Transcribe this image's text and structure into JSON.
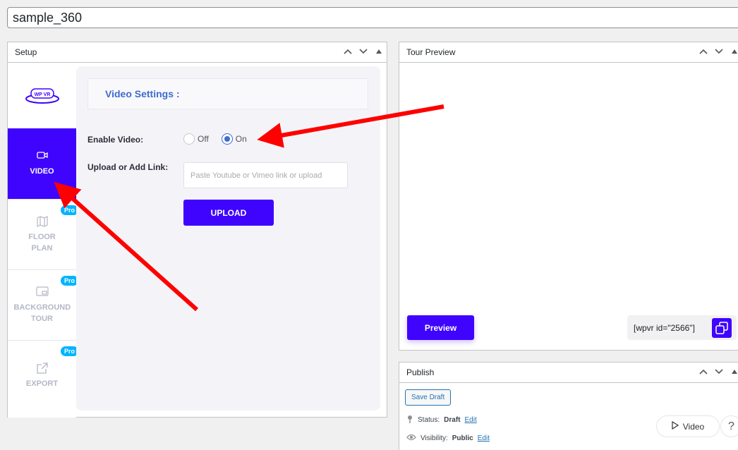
{
  "post_title": "sample_360",
  "setup_box": {
    "title": "Setup",
    "logo_text": "WP VR",
    "sidebar": [
      {
        "label": "VIDEO",
        "icon": "video-icon",
        "active": true,
        "pro": ""
      },
      {
        "label": "FLOOR PLAN",
        "icon": "map-icon",
        "active": false,
        "pro": "Pro"
      },
      {
        "label": "BACKGROUND TOUR",
        "icon": "background-tour-icon",
        "active": false,
        "pro": "Pro"
      },
      {
        "label": "EXPORT",
        "icon": "export-icon",
        "active": false,
        "pro": "Pro"
      }
    ],
    "video_settings": {
      "heading": "Video Settings :",
      "enable_label": "Enable Video:",
      "off_label": "Off",
      "on_label": "On",
      "selected": "On",
      "upload_label": "Upload or Add Link:",
      "link_placeholder": "Paste Youtube or Vimeo link or upload",
      "upload_button": "UPLOAD"
    }
  },
  "tour_preview": {
    "title": "Tour Preview",
    "preview_button": "Preview",
    "shortcode": "[wpvr id=\"2566\"]"
  },
  "publish_box": {
    "title": "Publish",
    "save_draft": "Save Draft",
    "status_label": "Status:",
    "status_value": "Draft",
    "visibility_label": "Visibility:",
    "visibility_value": "Public",
    "edit_link": "Edit",
    "video_pill": "Video",
    "help_pill": "?"
  },
  "colors": {
    "accent": "#3f04fe",
    "heading_blue": "#3f6bcf",
    "pro_badge": "#00b4ff",
    "annotation_arrow": "#ff0000"
  }
}
